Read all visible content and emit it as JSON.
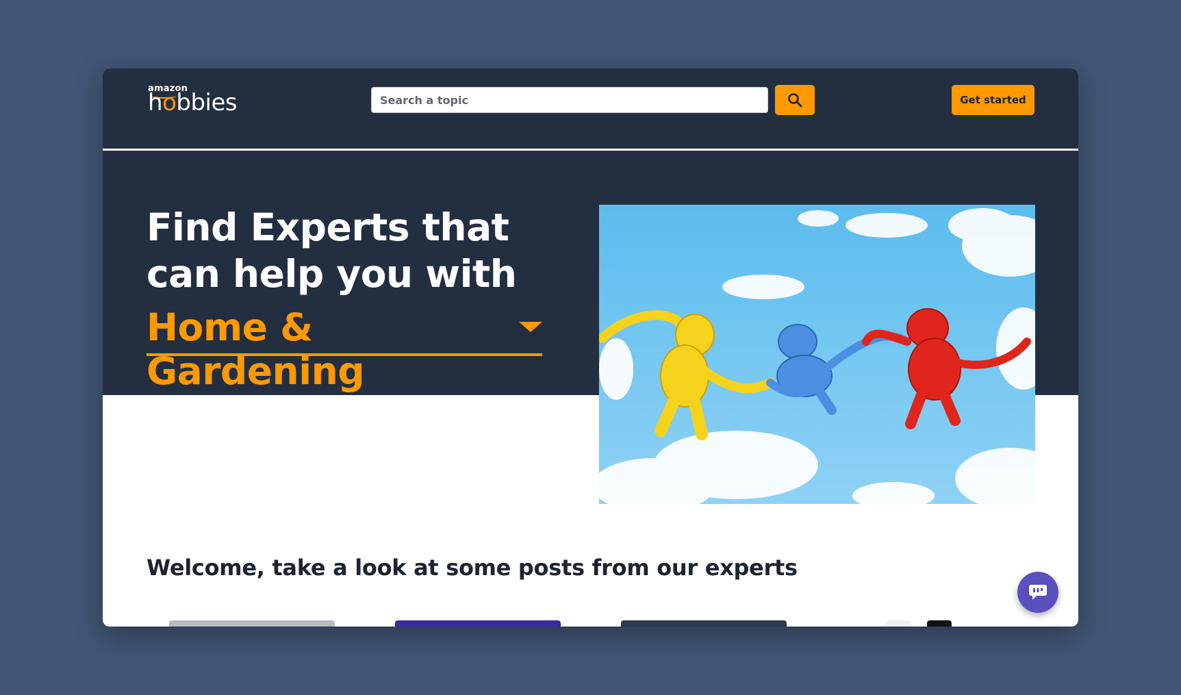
{
  "header": {
    "logo": {
      "brand_top": "amazon",
      "brand_main_pre": "h",
      "brand_main_o": "o",
      "brand_main_post": "bbies"
    },
    "search": {
      "placeholder": "Search a topic",
      "value": "",
      "button_icon": "search-icon"
    },
    "cta_label": "Get started"
  },
  "hero": {
    "headline": "Find Experts that can help you with",
    "topic_selected": "Home & Gardening",
    "topic_icon": "caret-down-icon",
    "image_description": "Blue sky with clouds and toy monkeys"
  },
  "posts": {
    "heading": "Welcome, take a look at some posts from our experts"
  },
  "chat": {
    "icon": "chat-icon"
  },
  "colors": {
    "page_bg": "#415675",
    "header_bg": "#232f40",
    "accent": "#ff9900",
    "chat_bg": "#5a4fbf"
  }
}
